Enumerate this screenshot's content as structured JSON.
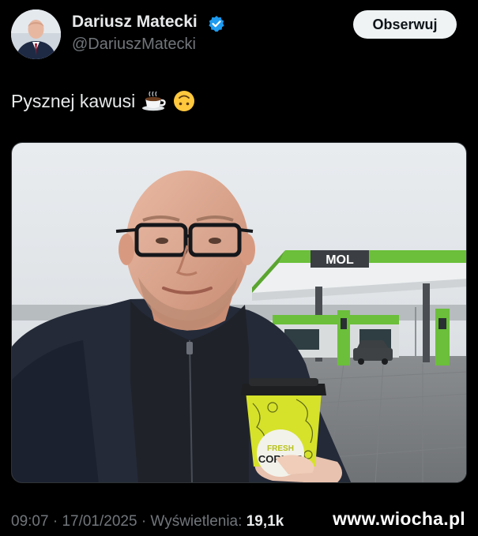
{
  "author": {
    "name": "Dariusz Matecki",
    "handle": "@DariuszMatecki",
    "verified_color": "#1d9bf0"
  },
  "follow_button": {
    "label": "Obserwuj"
  },
  "tweet": {
    "text": "Pysznej kawusi",
    "emojis": [
      "hot-beverage-icon",
      "upside-down-face-icon"
    ]
  },
  "media": {
    "cup_brand": "FRESH CORNER",
    "station_brand": "MOL"
  },
  "meta": {
    "time": "09:07",
    "separator": "·",
    "date": "17/01/2025",
    "views_label": "Wyświetlenia:",
    "views_count": "19,1k"
  },
  "watermark": {
    "text": "www.wiocha.pl"
  },
  "colors": {
    "background": "#000000",
    "primary_text": "#e7e9ea",
    "secondary_text": "#71767b",
    "button_bg": "#eff3f4",
    "mol_green": "#6bbf3a"
  }
}
